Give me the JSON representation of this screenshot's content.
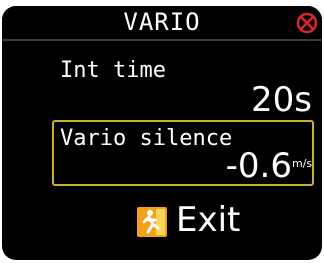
{
  "window": {
    "title": "VARIO"
  },
  "settings": {
    "int_time": {
      "label": "Int time",
      "value": "20s"
    },
    "vario_silence": {
      "label": "Vario silence",
      "value": "-0.6",
      "unit": "m/s"
    }
  },
  "footer": {
    "exit_label": "Exit"
  },
  "colors": {
    "background": "#000000",
    "text": "#ffffff",
    "selection_border": "#c9b02a",
    "close_icon": "#d8262b",
    "exit_icon": "#f4a21a"
  },
  "icons": {
    "close": "close-icon",
    "exit": "exit-running-man-icon"
  }
}
